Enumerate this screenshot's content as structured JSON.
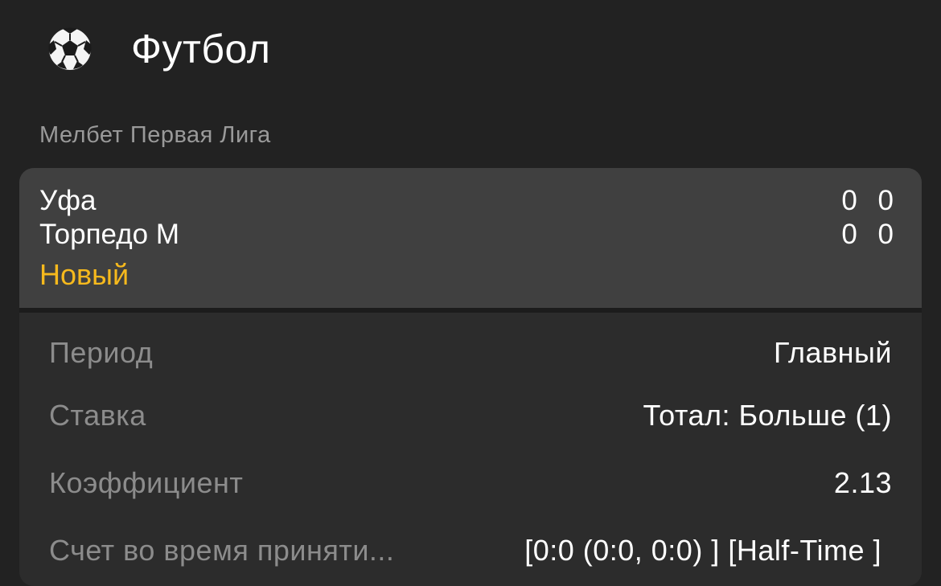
{
  "sport": {
    "icon": "soccer-ball-icon",
    "title": "Футбол"
  },
  "league": {
    "title": "Мелбет Первая Лига"
  },
  "match": {
    "teams": [
      {
        "name": "Уфа",
        "score": "0 0"
      },
      {
        "name": "Торпедо М",
        "score": "0 0"
      }
    ],
    "status": "Новый",
    "status_color": "#f6b91d"
  },
  "details": [
    {
      "label": "Период",
      "value": "Главный"
    },
    {
      "label": "Ставка",
      "value": "Тотал: Больше (1)"
    },
    {
      "label": "Коэффициент",
      "value": "2.13"
    },
    {
      "label": "Счет во время приняти...",
      "value": "[0:0 (0:0, 0:0) ] [Half-Time ]"
    }
  ]
}
